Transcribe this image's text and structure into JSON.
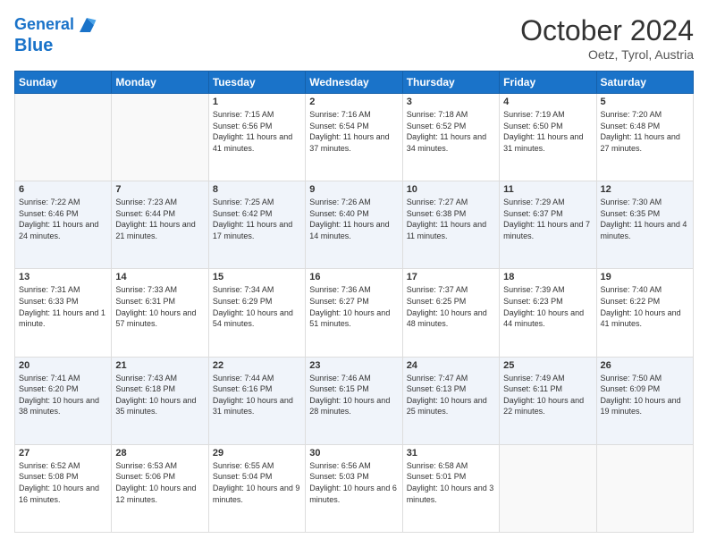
{
  "logo": {
    "line1": "General",
    "line2": "Blue"
  },
  "title": "October 2024",
  "subtitle": "Oetz, Tyrol, Austria",
  "days_of_week": [
    "Sunday",
    "Monday",
    "Tuesday",
    "Wednesday",
    "Thursday",
    "Friday",
    "Saturday"
  ],
  "weeks": [
    [
      {
        "day": "",
        "content": ""
      },
      {
        "day": "",
        "content": ""
      },
      {
        "day": "1",
        "sunrise": "7:15 AM",
        "sunset": "6:56 PM",
        "daylight": "11 hours and 41 minutes."
      },
      {
        "day": "2",
        "sunrise": "7:16 AM",
        "sunset": "6:54 PM",
        "daylight": "11 hours and 37 minutes."
      },
      {
        "day": "3",
        "sunrise": "7:18 AM",
        "sunset": "6:52 PM",
        "daylight": "11 hours and 34 minutes."
      },
      {
        "day": "4",
        "sunrise": "7:19 AM",
        "sunset": "6:50 PM",
        "daylight": "11 hours and 31 minutes."
      },
      {
        "day": "5",
        "sunrise": "7:20 AM",
        "sunset": "6:48 PM",
        "daylight": "11 hours and 27 minutes."
      }
    ],
    [
      {
        "day": "6",
        "sunrise": "7:22 AM",
        "sunset": "6:46 PM",
        "daylight": "11 hours and 24 minutes."
      },
      {
        "day": "7",
        "sunrise": "7:23 AM",
        "sunset": "6:44 PM",
        "daylight": "11 hours and 21 minutes."
      },
      {
        "day": "8",
        "sunrise": "7:25 AM",
        "sunset": "6:42 PM",
        "daylight": "11 hours and 17 minutes."
      },
      {
        "day": "9",
        "sunrise": "7:26 AM",
        "sunset": "6:40 PM",
        "daylight": "11 hours and 14 minutes."
      },
      {
        "day": "10",
        "sunrise": "7:27 AM",
        "sunset": "6:38 PM",
        "daylight": "11 hours and 11 minutes."
      },
      {
        "day": "11",
        "sunrise": "7:29 AM",
        "sunset": "6:37 PM",
        "daylight": "11 hours and 7 minutes."
      },
      {
        "day": "12",
        "sunrise": "7:30 AM",
        "sunset": "6:35 PM",
        "daylight": "11 hours and 4 minutes."
      }
    ],
    [
      {
        "day": "13",
        "sunrise": "7:31 AM",
        "sunset": "6:33 PM",
        "daylight": "11 hours and 1 minute."
      },
      {
        "day": "14",
        "sunrise": "7:33 AM",
        "sunset": "6:31 PM",
        "daylight": "10 hours and 57 minutes."
      },
      {
        "day": "15",
        "sunrise": "7:34 AM",
        "sunset": "6:29 PM",
        "daylight": "10 hours and 54 minutes."
      },
      {
        "day": "16",
        "sunrise": "7:36 AM",
        "sunset": "6:27 PM",
        "daylight": "10 hours and 51 minutes."
      },
      {
        "day": "17",
        "sunrise": "7:37 AM",
        "sunset": "6:25 PM",
        "daylight": "10 hours and 48 minutes."
      },
      {
        "day": "18",
        "sunrise": "7:39 AM",
        "sunset": "6:23 PM",
        "daylight": "10 hours and 44 minutes."
      },
      {
        "day": "19",
        "sunrise": "7:40 AM",
        "sunset": "6:22 PM",
        "daylight": "10 hours and 41 minutes."
      }
    ],
    [
      {
        "day": "20",
        "sunrise": "7:41 AM",
        "sunset": "6:20 PM",
        "daylight": "10 hours and 38 minutes."
      },
      {
        "day": "21",
        "sunrise": "7:43 AM",
        "sunset": "6:18 PM",
        "daylight": "10 hours and 35 minutes."
      },
      {
        "day": "22",
        "sunrise": "7:44 AM",
        "sunset": "6:16 PM",
        "daylight": "10 hours and 31 minutes."
      },
      {
        "day": "23",
        "sunrise": "7:46 AM",
        "sunset": "6:15 PM",
        "daylight": "10 hours and 28 minutes."
      },
      {
        "day": "24",
        "sunrise": "7:47 AM",
        "sunset": "6:13 PM",
        "daylight": "10 hours and 25 minutes."
      },
      {
        "day": "25",
        "sunrise": "7:49 AM",
        "sunset": "6:11 PM",
        "daylight": "10 hours and 22 minutes."
      },
      {
        "day": "26",
        "sunrise": "7:50 AM",
        "sunset": "6:09 PM",
        "daylight": "10 hours and 19 minutes."
      }
    ],
    [
      {
        "day": "27",
        "sunrise": "6:52 AM",
        "sunset": "5:08 PM",
        "daylight": "10 hours and 16 minutes."
      },
      {
        "day": "28",
        "sunrise": "6:53 AM",
        "sunset": "5:06 PM",
        "daylight": "10 hours and 12 minutes."
      },
      {
        "day": "29",
        "sunrise": "6:55 AM",
        "sunset": "5:04 PM",
        "daylight": "10 hours and 9 minutes."
      },
      {
        "day": "30",
        "sunrise": "6:56 AM",
        "sunset": "5:03 PM",
        "daylight": "10 hours and 6 minutes."
      },
      {
        "day": "31",
        "sunrise": "6:58 AM",
        "sunset": "5:01 PM",
        "daylight": "10 hours and 3 minutes."
      },
      {
        "day": "",
        "content": ""
      },
      {
        "day": "",
        "content": ""
      }
    ]
  ]
}
